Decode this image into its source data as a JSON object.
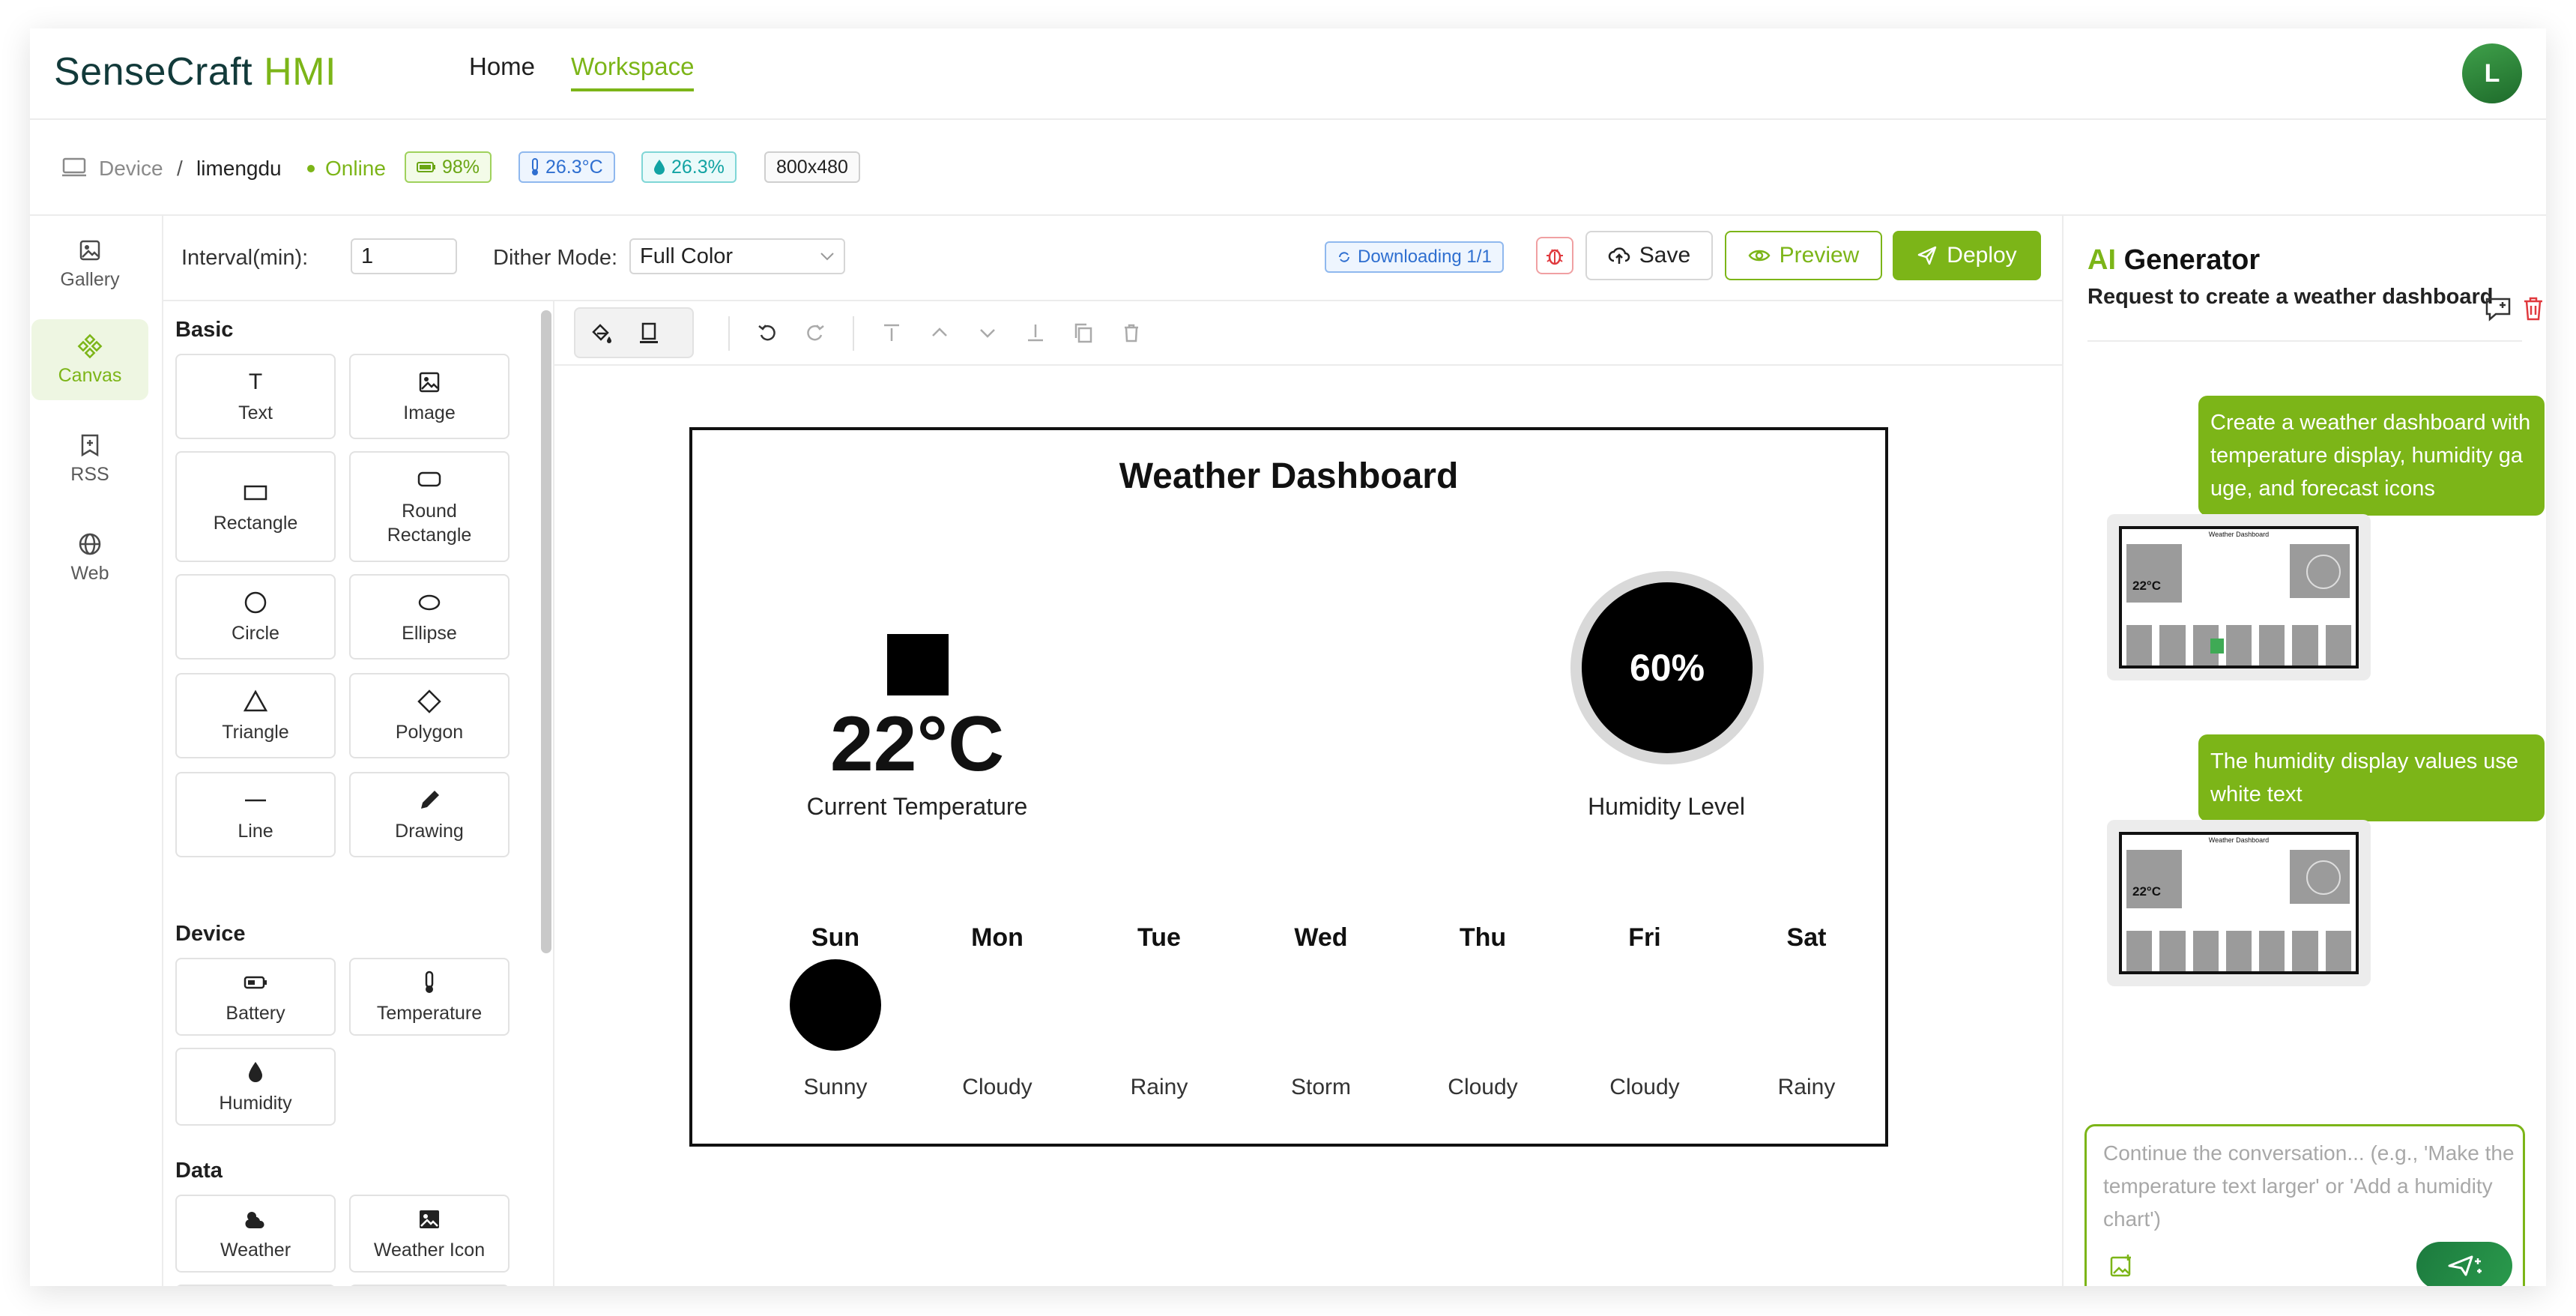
{
  "app": {
    "logo_main": "SenseCraft",
    "logo_accent": "HMI",
    "nav": {
      "home": "Home",
      "workspace": "Workspace"
    },
    "avatar_initial": "L"
  },
  "status": {
    "device_label": "Device",
    "separator": "/",
    "device_name": "limengdu",
    "online": "Online",
    "battery": "98%",
    "temperature": "26.3°C",
    "humidity": "26.3%",
    "resolution": "800x480"
  },
  "rail": {
    "gallery": "Gallery",
    "canvas": "Canvas",
    "rss": "RSS",
    "web": "Web"
  },
  "toolbar": {
    "interval_label": "Interval(min):",
    "interval_value": "1",
    "dither_label": "Dither Mode:",
    "dither_value": "Full Color",
    "downloading": "Downloading 1/1",
    "save": "Save",
    "preview": "Preview",
    "deploy": "Deploy"
  },
  "panel": {
    "basic_title": "Basic",
    "device_title": "Device",
    "data_title": "Data",
    "basic": {
      "text": "Text",
      "image": "Image",
      "rectangle": "Rectangle",
      "round_rectangle": "Round Rectangle",
      "circle": "Circle",
      "ellipse": "Ellipse",
      "triangle": "Triangle",
      "polygon": "Polygon",
      "line": "Line",
      "drawing": "Drawing"
    },
    "device": {
      "battery": "Battery",
      "temperature": "Temperature",
      "humidity": "Humidity"
    },
    "data": {
      "weather": "Weather",
      "weather_icon": "Weather Icon"
    }
  },
  "board": {
    "title": "Weather Dashboard",
    "temperature": "22°C",
    "temperature_caption": "Current Temperature",
    "humidity": "60%",
    "humidity_caption": "Humidity Level",
    "forecast": {
      "days": [
        "Sun",
        "Mon",
        "Tue",
        "Wed",
        "Thu",
        "Fri",
        "Sat"
      ],
      "conditions": [
        "Sunny",
        "Cloudy",
        "Rainy",
        "Storm",
        "Cloudy",
        "Cloudy",
        "Rainy"
      ]
    }
  },
  "ai": {
    "title_accent": "AI",
    "title_rest": "Generator",
    "subtitle": "Request to create a weather dashboard",
    "messages": [
      "Create a weather dashboard with temperature display, humidity ga uge, and forecast icons",
      "The humidity display values use white text"
    ],
    "thumb_title": "Weather Dashboard",
    "thumb_temp": "22°C",
    "chat_placeholder": "Continue the conversation... (e.g., 'Make the temperature text larger' or 'Add a humidity chart')"
  },
  "colors": {
    "accent": "#7cb518",
    "danger": "#e0393e",
    "info": "#2f7de1",
    "teal": "#12a3a3"
  }
}
